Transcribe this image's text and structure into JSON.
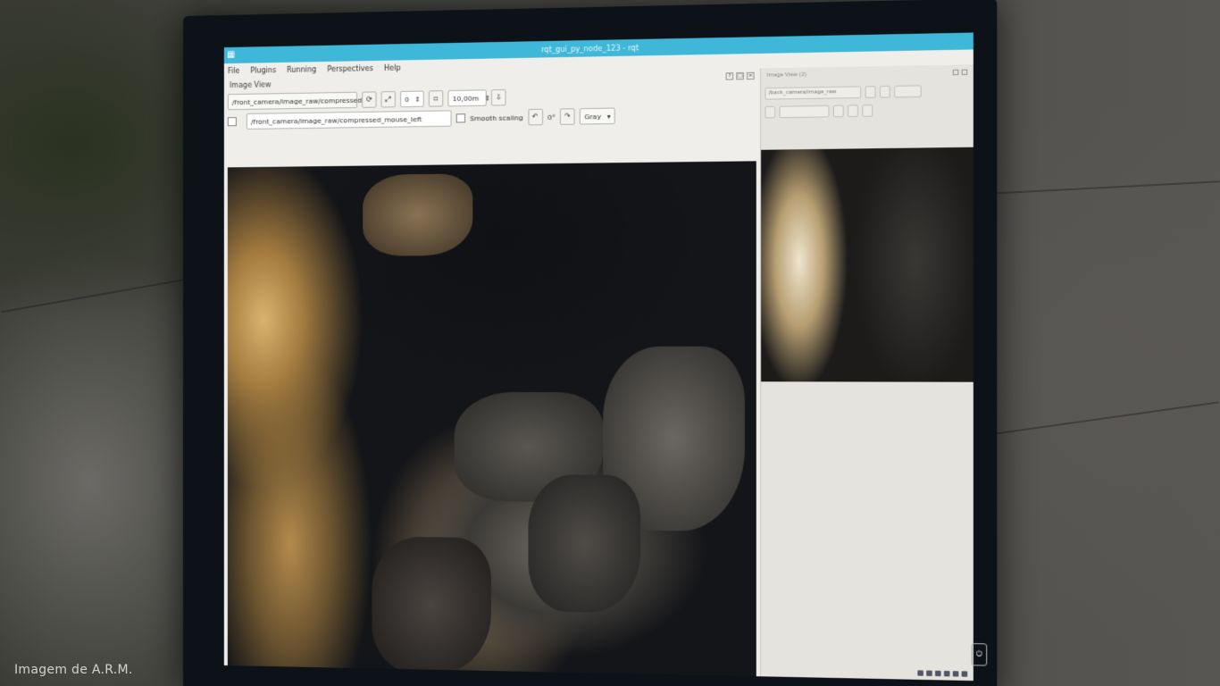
{
  "window": {
    "title": "rqt_gui_py_node_123 - rqt",
    "menu": [
      "File",
      "Plugins",
      "Running",
      "Perspectives",
      "Help"
    ]
  },
  "image_view": {
    "panel_title": "Image View",
    "topic": "/front_camera/image_raw/compressed",
    "zoom_value": "0",
    "max_range": "10,00m",
    "mouse_topic": "/front_camera/image_raw/compressed_mouse_left",
    "smooth_scaling_label": "Smooth scaling",
    "rotation": "0°",
    "color_scheme": "Gray"
  },
  "side_view": {
    "panel_title": "Image View (2)",
    "topic": "/back_camera/image_raw"
  },
  "watermark": "Imagem de A.R.M."
}
